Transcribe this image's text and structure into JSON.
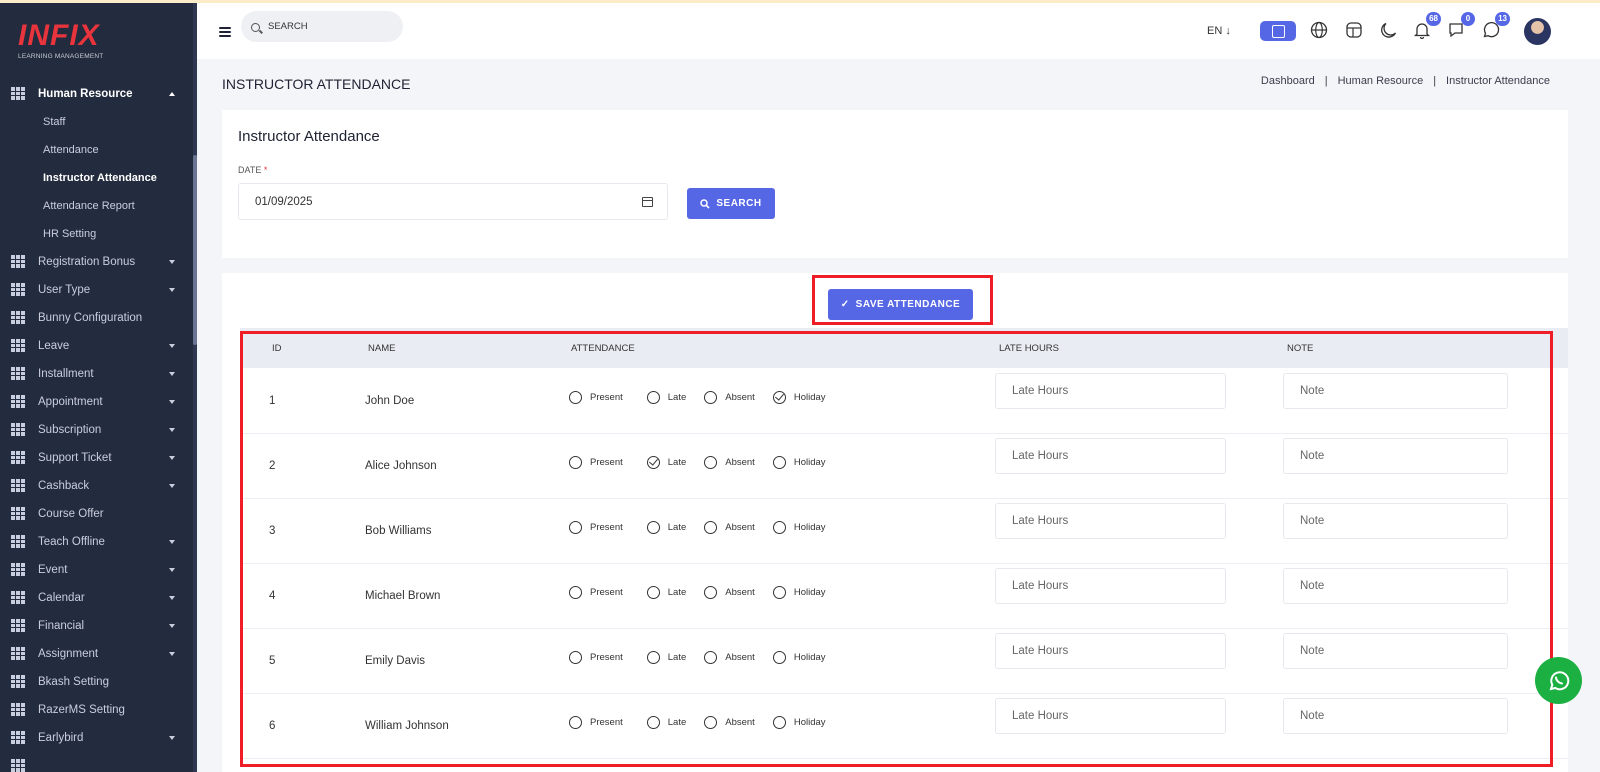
{
  "brand": {
    "logo_text": "INFIX",
    "tagline": "LEARNING MANAGEMENT"
  },
  "header": {
    "search_placeholder": "SEARCH",
    "language": "EN ↓",
    "notifications_count": "68",
    "messages_count": "0",
    "whatsapp_count": "13"
  },
  "sidebar": {
    "section": {
      "label": "Human Resource"
    },
    "sub_items": [
      {
        "label": "Staff"
      },
      {
        "label": "Attendance"
      },
      {
        "label": "Instructor Attendance"
      },
      {
        "label": "Attendance Report"
      },
      {
        "label": "HR Setting"
      }
    ],
    "items": [
      {
        "label": "Registration Bonus",
        "caret": true
      },
      {
        "label": "User Type",
        "caret": true
      },
      {
        "label": "Bunny Configuration",
        "caret": false
      },
      {
        "label": "Leave",
        "caret": true
      },
      {
        "label": "Installment",
        "caret": true
      },
      {
        "label": "Appointment",
        "caret": true
      },
      {
        "label": "Subscription",
        "caret": true
      },
      {
        "label": "Support Ticket",
        "caret": true
      },
      {
        "label": "Cashback",
        "caret": true
      },
      {
        "label": "Course Offer",
        "caret": false
      },
      {
        "label": "Teach Offline",
        "caret": true
      },
      {
        "label": "Event",
        "caret": true
      },
      {
        "label": "Calendar",
        "caret": true
      },
      {
        "label": "Financial",
        "caret": true
      },
      {
        "label": "Assignment",
        "caret": true
      },
      {
        "label": "Bkash Setting",
        "caret": false
      },
      {
        "label": "RazerMS Setting",
        "caret": false
      },
      {
        "label": "Earlybird",
        "caret": true
      }
    ]
  },
  "page": {
    "title": "INSTRUCTOR ATTENDANCE",
    "breadcrumb": [
      "Dashboard",
      "Human Resource",
      "Instructor Attendance"
    ],
    "breadcrumb_sep": "|"
  },
  "filter": {
    "heading": "Instructor Attendance",
    "date_label": "DATE",
    "required_mark": "*",
    "date_value": "01/09/2025",
    "search_button": "SEARCH"
  },
  "attendance": {
    "save_button": "SAVE ATTENDANCE",
    "columns": [
      "ID",
      "NAME",
      "ATTENDANCE",
      "LATE HOURS",
      "NOTE"
    ],
    "options": [
      "Present",
      "Late",
      "Absent",
      "Holiday"
    ],
    "late_placeholder": "Late Hours",
    "note_placeholder": "Note",
    "rows": [
      {
        "id": "1",
        "name": "John Doe",
        "selected": "Holiday"
      },
      {
        "id": "2",
        "name": "Alice Johnson",
        "selected": "Late"
      },
      {
        "id": "3",
        "name": "Bob Williams",
        "selected": ""
      },
      {
        "id": "4",
        "name": "Michael Brown",
        "selected": ""
      },
      {
        "id": "5",
        "name": "Emily Davis",
        "selected": ""
      },
      {
        "id": "6",
        "name": "William Johnson",
        "selected": ""
      }
    ]
  },
  "colors": {
    "accent": "#5667e6",
    "sidebar": "#232b3e",
    "highlight": "#ef1d25",
    "whatsapp": "#1cb043"
  }
}
